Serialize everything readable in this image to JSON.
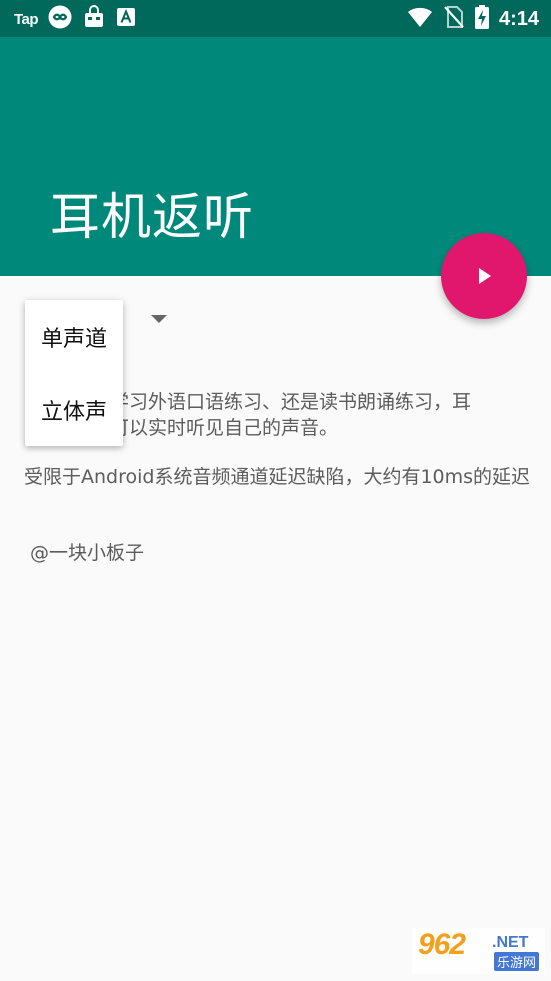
{
  "status_bar": {
    "tap_label": "Tap",
    "time": "4:14",
    "icons": [
      "infinity-app-icon",
      "shopping-bag-icon",
      "font-a-icon",
      "wifi-icon",
      "no-sim-icon",
      "battery-charging-icon"
    ]
  },
  "app_bar": {
    "title": "耳机返听",
    "background_color": "#00897b",
    "status_color": "#00695c"
  },
  "fab": {
    "icon": "play-icon",
    "color": "#e0176c"
  },
  "dropdown": {
    "options": [
      "单声道",
      "立体声"
    ]
  },
  "body": {
    "paragraph_1_visible_start": "学习外语口语练习、还是读书朗诵练习，耳",
    "paragraph_1_visible_end": "可以实时听见自己的声音。",
    "paragraph_2": " 受限于Android系统音频通道延迟缺陷，大约有10ms的延迟",
    "author": "@一块小板子"
  },
  "watermark": {
    "main": "962",
    "domain": ".NET",
    "sub": "乐游网"
  }
}
